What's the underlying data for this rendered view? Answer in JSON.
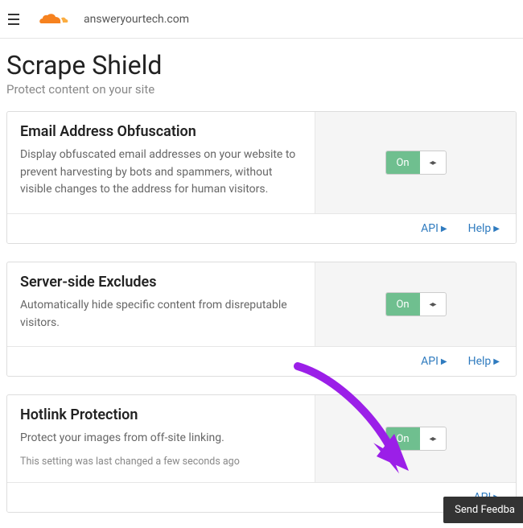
{
  "header": {
    "domain": "answeryourtech.com"
  },
  "page": {
    "title": "Scrape Shield",
    "subtitle": "Protect content on your site"
  },
  "cards": [
    {
      "title": "Email Address Obfuscation",
      "desc": "Display obfuscated email addresses on your website to prevent harvesting by bots and spammers, without visible changes to the address for human visitors.",
      "toggle": "On",
      "note": "",
      "api": "API",
      "help": "Help"
    },
    {
      "title": "Server-side Excludes",
      "desc": "Automatically hide specific content from disreputable visitors.",
      "toggle": "On",
      "note": "",
      "api": "API",
      "help": "Help"
    },
    {
      "title": "Hotlink Protection",
      "desc": "Protect your images from off-site linking.",
      "toggle": "On",
      "note": "This setting was last changed a few seconds ago",
      "api": "API",
      "help": ""
    }
  ],
  "feedback": "Send Feedba",
  "colors": {
    "accent_orange": "#f6821f",
    "toggle_green": "#6fbf8f",
    "link_blue": "#2f7bbf",
    "arrow_purple": "#9b1fe8"
  }
}
